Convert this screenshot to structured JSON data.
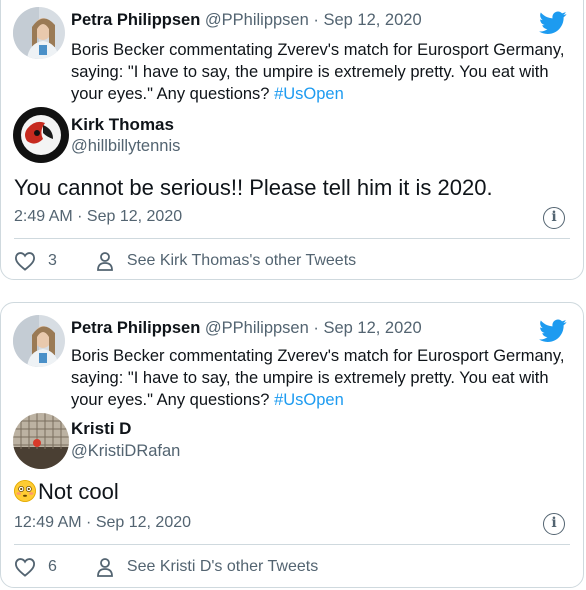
{
  "tweets": [
    {
      "quoted": {
        "name": "Petra Philippsen",
        "handle_date": "@PPhilippsen · Sep 12, 2020",
        "text_before": "Boris Becker commentating Zverev's match for Eurosport Germany, saying: \"I have to say, the umpire is extremely pretty. You eat with your eyes.\" Any questions? ",
        "hashtag": "#UsOpen"
      },
      "reply": {
        "name": "Kirk Thomas",
        "handle": "@hillbillytennis",
        "text": "You cannot be serious!! Please tell him it is 2020.",
        "timestamp": "2:49 AM · Sep 12, 2020",
        "like_count": "3",
        "see_other": "See Kirk Thomas's other Tweets"
      }
    },
    {
      "quoted": {
        "name": "Petra Philippsen",
        "handle_date": "@PPhilippsen · Sep 12, 2020",
        "text_before": "Boris Becker commentating Zverev's match for Eurosport Germany, saying: \"I have to say, the umpire is extremely pretty. You eat with your eyes.\" Any questions? ",
        "hashtag": "#UsOpen"
      },
      "reply": {
        "name": "Kristi D",
        "handle": "@KristiDRafan",
        "emoji": "flushed-face-emoji",
        "text": "Not cool",
        "timestamp": "12:49 AM · Sep 12, 2020",
        "like_count": "6",
        "see_other": "See Kristi D's other Tweets"
      }
    }
  ],
  "icons": {
    "twitter": "twitter-bird-icon",
    "info": "info-icon",
    "like": "heart-icon",
    "profile": "person-icon"
  },
  "colors": {
    "accent": "#1d9bf0",
    "secondary_text": "#536471",
    "border": "#cfd9de"
  }
}
